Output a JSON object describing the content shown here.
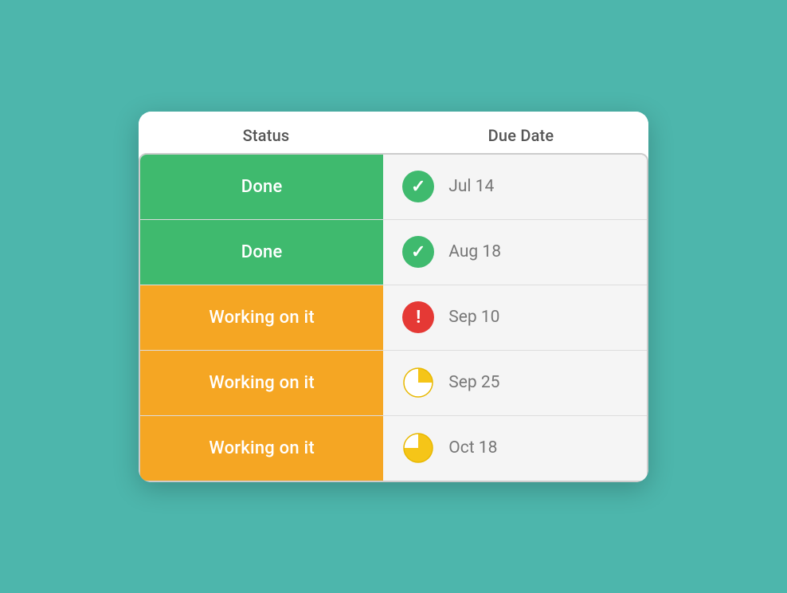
{
  "header": {
    "status_label": "Status",
    "due_date_label": "Due Date"
  },
  "rows": [
    {
      "status": "Done",
      "status_type": "done",
      "icon_type": "done",
      "date": "Jul 14"
    },
    {
      "status": "Done",
      "status_type": "done",
      "icon_type": "done",
      "date": "Aug 18"
    },
    {
      "status": "Working on it",
      "status_type": "working",
      "icon_type": "overdue",
      "date": "Sep 10"
    },
    {
      "status": "Working on it",
      "status_type": "working",
      "icon_type": "clock-partial",
      "date": "Sep 25"
    },
    {
      "status": "Working on it",
      "status_type": "working",
      "icon_type": "clock-almost",
      "date": "Oct 18"
    }
  ],
  "colors": {
    "done_bg": "#3fba6e",
    "working_bg": "#f5a623",
    "overdue_icon": "#e53935",
    "clock_icon": "#f5c518"
  }
}
